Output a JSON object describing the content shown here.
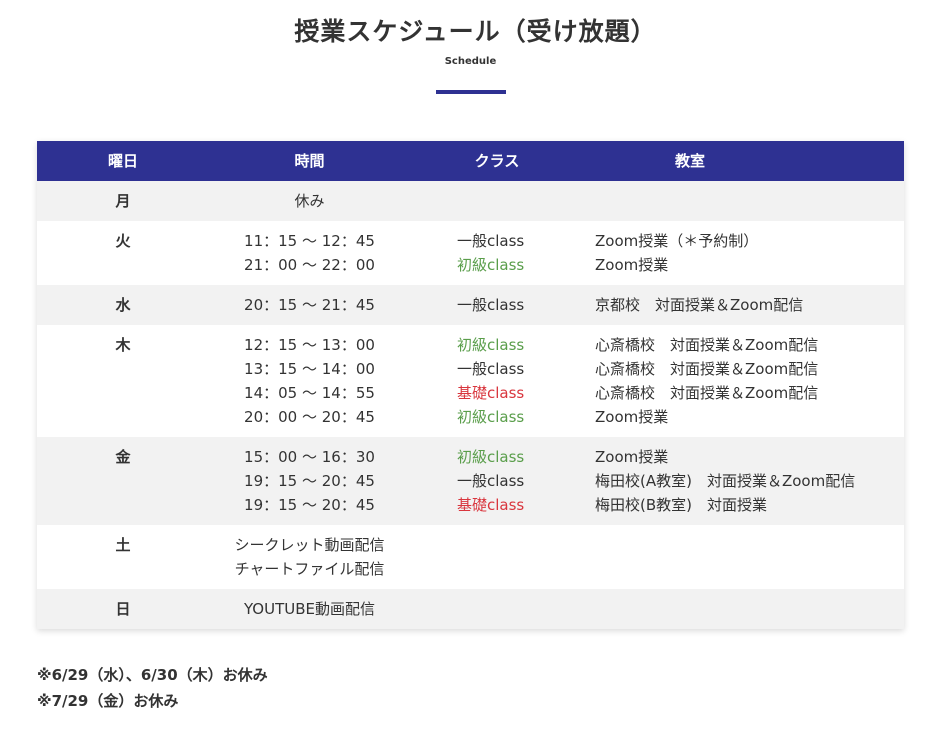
{
  "header": {
    "title": "授業スケジュール（受け放題）",
    "subtitle": "Schedule",
    "accent_color": "#2e3192"
  },
  "table": {
    "columns": [
      "曜日",
      "時間",
      "クラス",
      "教室"
    ],
    "rows": [
      {
        "day": "月",
        "shade": "alt",
        "note": [
          "休み"
        ],
        "sessions": []
      },
      {
        "day": "火",
        "shade": "plain",
        "note": [],
        "sessions": [
          {
            "time": "11：15 ～ 12：45",
            "class": "一般class",
            "class_type": "general",
            "room": "Zoom授業（＊予約制）"
          },
          {
            "time": "21：00 ～ 22：00",
            "class": "初級class",
            "class_type": "beginner",
            "room": "Zoom授業"
          }
        ]
      },
      {
        "day": "水",
        "shade": "alt",
        "note": [],
        "sessions": [
          {
            "time": "20：15 ～ 21：45",
            "class": "一般class",
            "class_type": "general",
            "room": "京都校　対面授業＆Zoom配信"
          }
        ]
      },
      {
        "day": "木",
        "shade": "plain",
        "note": [],
        "sessions": [
          {
            "time": "12：15 ～ 13：00",
            "class": "初級class",
            "class_type": "beginner",
            "room": "心斎橋校　対面授業＆Zoom配信"
          },
          {
            "time": "13：15 ～ 14：00",
            "class": "一般class",
            "class_type": "general",
            "room": "心斎橋校　対面授業＆Zoom配信"
          },
          {
            "time": "14：05 ～ 14：55",
            "class": "基礎class",
            "class_type": "basic",
            "room": "心斎橋校　対面授業＆Zoom配信"
          },
          {
            "time": "20：00 ～ 20：45",
            "class": "初級class",
            "class_type": "beginner",
            "room": "Zoom授業"
          }
        ]
      },
      {
        "day": "金",
        "shade": "alt",
        "note": [],
        "sessions": [
          {
            "time": "15：00 ～ 16：30",
            "class": "初級class",
            "class_type": "beginner",
            "room": "Zoom授業"
          },
          {
            "time": "19：15 ～ 20：45",
            "class": "一般class",
            "class_type": "general",
            "room": "梅田校(A教室)　対面授業＆Zoom配信"
          },
          {
            "time": "19：15 ～ 20：45",
            "class": "基礎class",
            "class_type": "basic",
            "room": "梅田校(B教室)　対面授業"
          }
        ]
      },
      {
        "day": "土",
        "shade": "plain",
        "note": [
          "シークレット動画配信",
          "チャートファイル配信"
        ],
        "sessions": []
      },
      {
        "day": "日",
        "shade": "alt",
        "note": [
          "YOUTUBE動画配信"
        ],
        "sessions": []
      }
    ],
    "class_colors": {
      "general": "#333333",
      "beginner": "#5a9e4b",
      "basic": "#d9363e"
    }
  },
  "notes": [
    "※6/29（水）、6/30（木）お休み",
    "※7/29（金）お休み"
  ]
}
